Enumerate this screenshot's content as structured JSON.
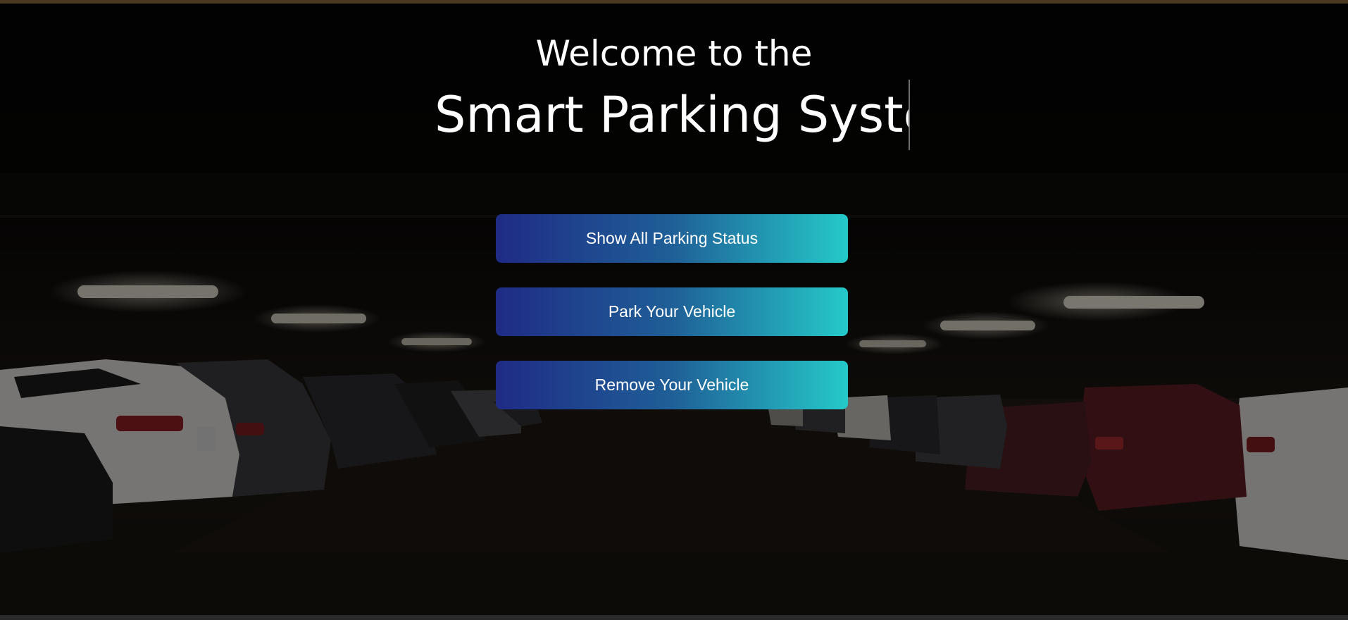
{
  "header": {
    "welcome": "Welcome to the",
    "title": "Smart Parking System"
  },
  "actions": {
    "show_status": "Show All Parking Status",
    "park": "Park Your Vehicle",
    "remove": "Remove Your Vehicle"
  },
  "colors": {
    "button_gradient_start": "#1f2b85",
    "button_gradient_end": "#25c9c9",
    "text": "#ffffff"
  }
}
